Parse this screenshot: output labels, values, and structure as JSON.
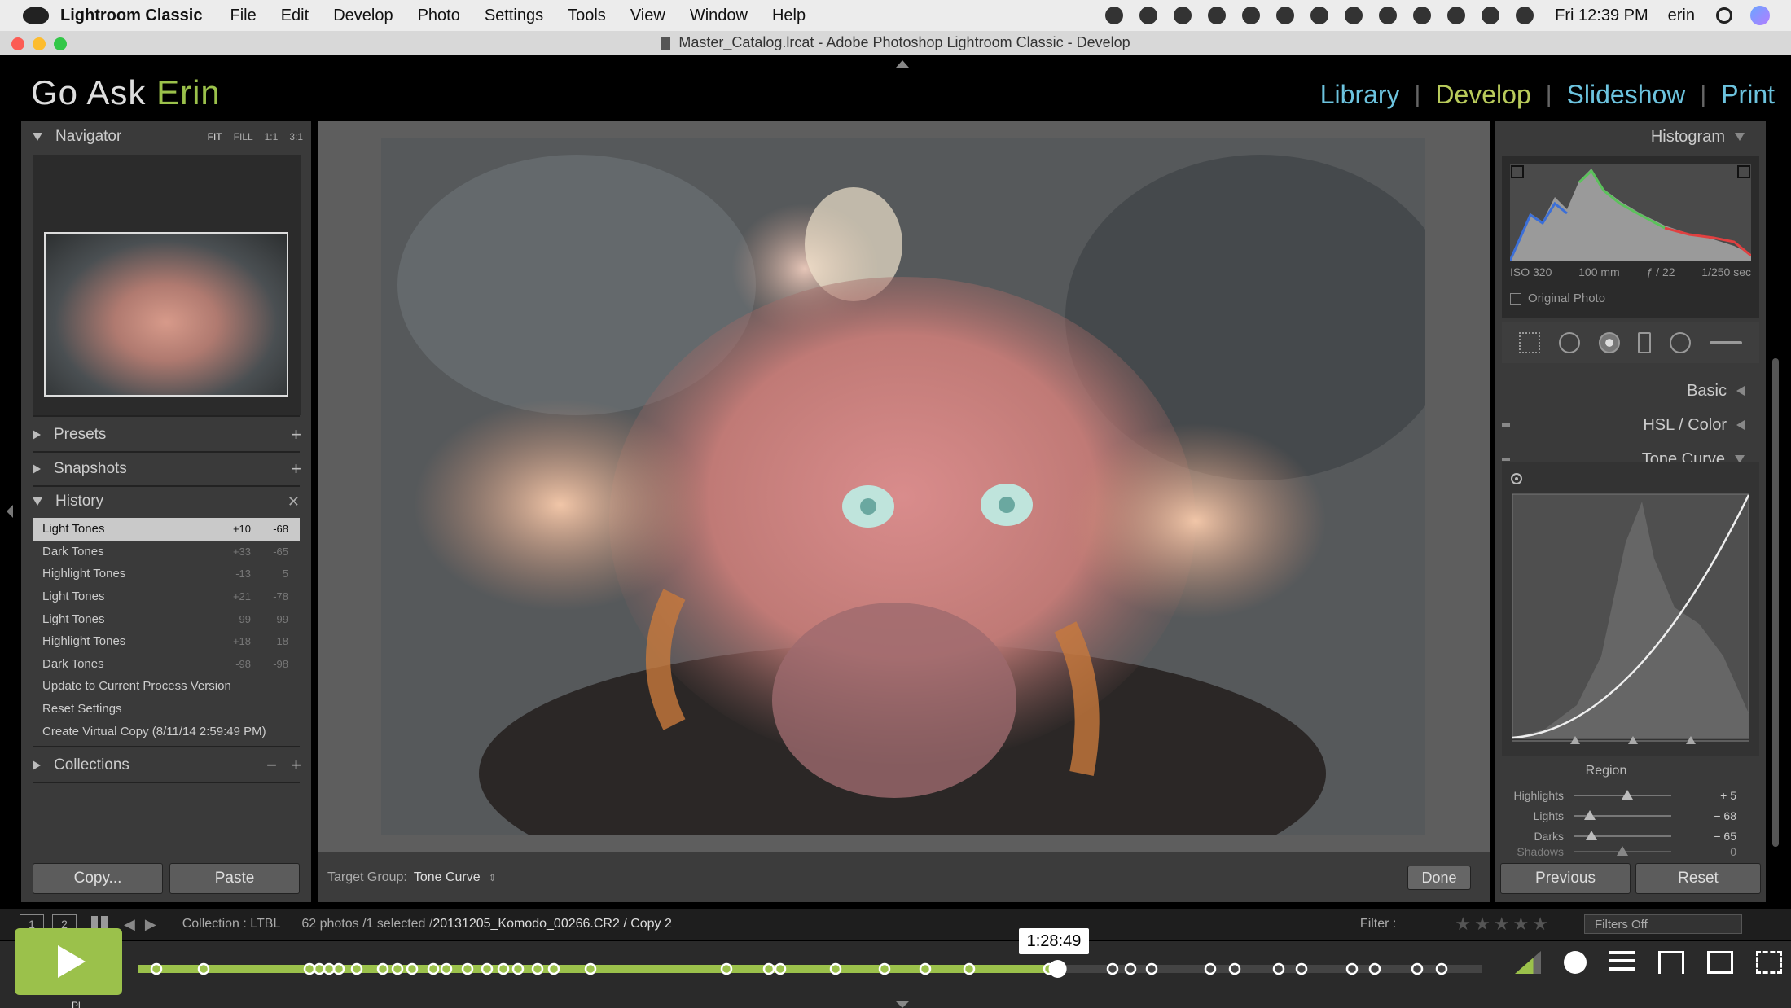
{
  "menubar": {
    "app_name": "Lightroom Classic",
    "items": [
      "File",
      "Edit",
      "Develop",
      "Photo",
      "Settings",
      "Tools",
      "View",
      "Window",
      "Help"
    ],
    "clock": "Fri 12:39 PM",
    "user": "erin"
  },
  "window": {
    "title": "Master_Catalog.lrcat - Adobe Photoshop Lightroom Classic - Develop"
  },
  "identity": {
    "part1": "Go Ask ",
    "part2": "Erin",
    "accent_color": "#9bc14b"
  },
  "modules": {
    "library": "Library",
    "develop": "Develop",
    "slideshow": "Slideshow",
    "print": "Print",
    "sep": "|"
  },
  "left_panel": {
    "navigator": {
      "title": "Navigator",
      "zoom": [
        "FIT",
        "FILL",
        "1:1",
        "3:1"
      ]
    },
    "presets": "Presets",
    "snapshots": "Snapshots",
    "history": {
      "title": "History",
      "items": [
        {
          "label": "Light Tones",
          "v1": "+10",
          "v2": "-68",
          "selected": true
        },
        {
          "label": "Dark Tones",
          "v1": "+33",
          "v2": "-65"
        },
        {
          "label": "Highlight Tones",
          "v1": "-13",
          "v2": "5"
        },
        {
          "label": "Light Tones",
          "v1": "+21",
          "v2": "-78"
        },
        {
          "label": "Light Tones",
          "v1": "99",
          "v2": "-99"
        },
        {
          "label": "Highlight Tones",
          "v1": "+18",
          "v2": "18"
        },
        {
          "label": "Dark Tones",
          "v1": "-98",
          "v2": "-98"
        },
        {
          "label": "Update to Current Process Version",
          "v1": "",
          "v2": ""
        },
        {
          "label": "Reset Settings",
          "v1": "",
          "v2": ""
        },
        {
          "label": "Create Virtual Copy (8/11/14 2:59:49 PM)",
          "v1": "",
          "v2": ""
        }
      ]
    },
    "collections": "Collections",
    "copy_btn": "Copy...",
    "paste_btn": "Paste"
  },
  "toolbar": {
    "target_label": "Target Group:",
    "target_value": "Tone Curve",
    "done": "Done"
  },
  "right_panel": {
    "histogram_title": "Histogram",
    "iso": "ISO 320",
    "focal": "100 mm",
    "aperture": "ƒ / 22",
    "shutter": "1/250 sec",
    "original_photo": "Original Photo",
    "basic": "Basic",
    "hsl": "HSL / Color",
    "tone_curve": "Tone Curve",
    "region_title": "Region",
    "region": [
      {
        "label": "Highlights",
        "value": "+ 5",
        "level": 0.55
      },
      {
        "label": "Lights",
        "value": "− 68",
        "level": 0.17
      },
      {
        "label": "Darks",
        "value": "− 65",
        "level": 0.18
      },
      {
        "label": "Shadows",
        "value": "0",
        "level": 0.5
      }
    ],
    "previous": "Previous",
    "reset": "Reset"
  },
  "filmstrip": {
    "page1": "1",
    "page2": "2",
    "collection": "Collection : LTBL",
    "count": "62 photos /1 selected /",
    "filename": "20131205_Komodo_00266.CR2 / Copy 2",
    "filter_label": "Filter :",
    "filters_off": "Filters Off"
  },
  "player": {
    "time": "1:28:49",
    "progress": 0.684,
    "caption": "Pl"
  }
}
